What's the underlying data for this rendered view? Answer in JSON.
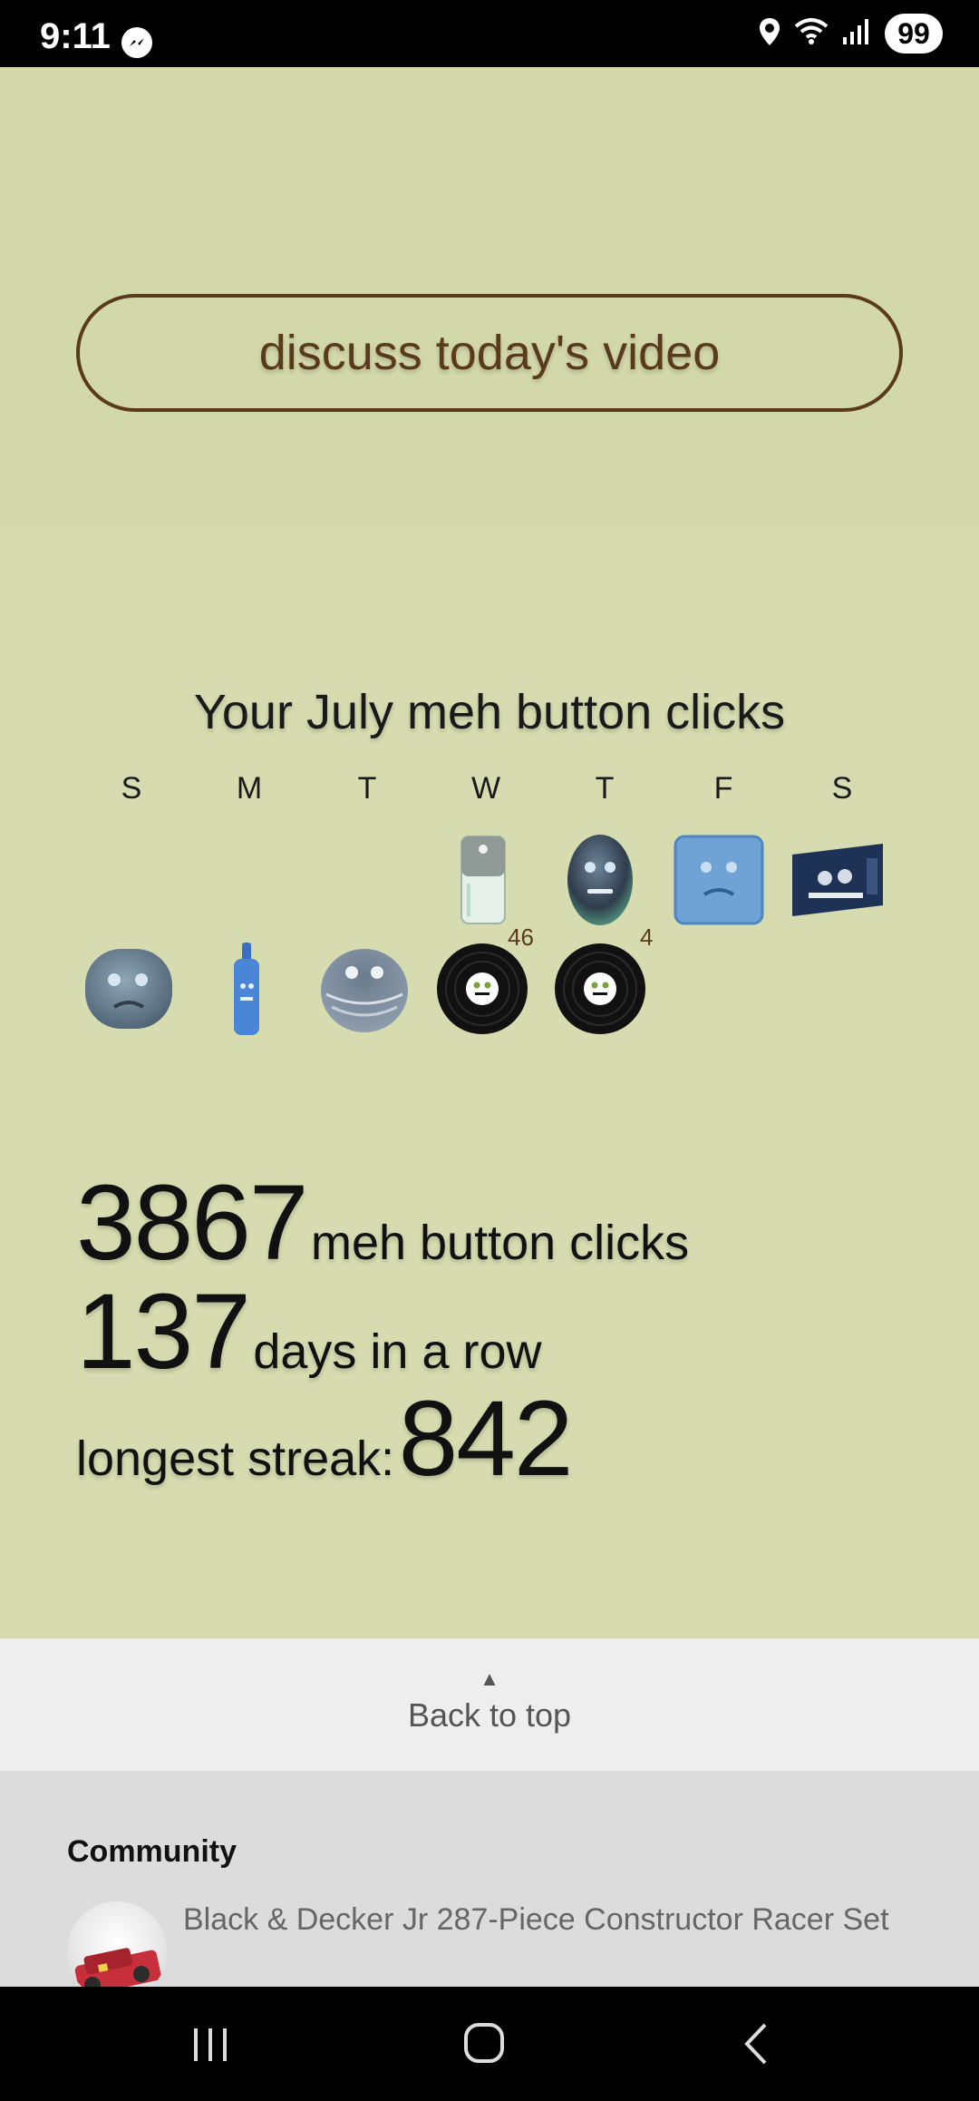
{
  "status_bar": {
    "time": "9:11",
    "battery": "99",
    "icons": [
      "messenger-icon",
      "location-icon",
      "wifi-icon",
      "signal-icon"
    ]
  },
  "discuss_button_label": "discuss today's video",
  "calendar": {
    "title": "Your July meh button clicks",
    "weekdays": [
      "S",
      "M",
      "T",
      "W",
      "T",
      "F",
      "S"
    ],
    "week1": [
      {
        "day": "W",
        "icon": "canister-icon"
      },
      {
        "day": "T",
        "icon": "smiling-egg-icon"
      },
      {
        "day": "F",
        "icon": "frowning-square-icon"
      },
      {
        "day": "S",
        "icon": "circuit-card-icon"
      }
    ],
    "week2": [
      {
        "day": "S",
        "icon": "sad-blob-icon"
      },
      {
        "day": "M",
        "icon": "blue-bottle-icon"
      },
      {
        "day": "T",
        "icon": "grinning-shell-icon"
      },
      {
        "day": "W",
        "icon": "vinyl-record-icon",
        "count": "46"
      },
      {
        "day": "T",
        "icon": "vinyl-record-icon",
        "count": "4"
      }
    ]
  },
  "stats": {
    "clicks_value": "3867",
    "clicks_label": "meh button clicks",
    "streak_value": "137",
    "streak_label": "days in a row",
    "longest_label": "longest streak:",
    "longest_value": "842"
  },
  "back_to_top": {
    "arrow": "▲",
    "label": "Back to top"
  },
  "community": {
    "title": "Community",
    "item_title": "Black & Decker Jr 287-Piece Constructor Racer Set"
  },
  "colors": {
    "accent_brown": "#5a3a1d",
    "background_green": "#d4d9ac"
  }
}
